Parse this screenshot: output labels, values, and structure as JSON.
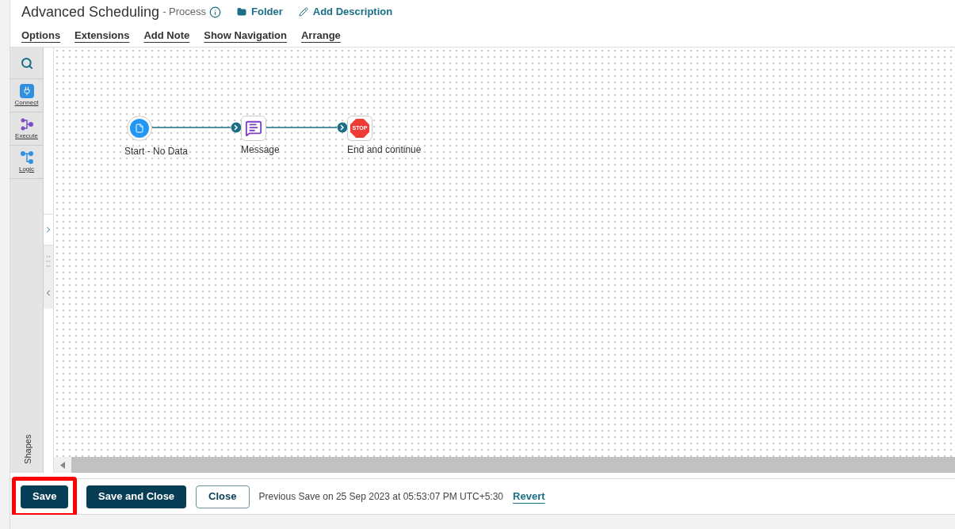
{
  "header": {
    "title": "Advanced Scheduling",
    "subtitle": "- Process",
    "links": [
      {
        "kind": "folder",
        "label": "Folder"
      },
      {
        "kind": "edit",
        "label": "Add Description"
      }
    ]
  },
  "menu": [
    "Options",
    "Extensions",
    "Add Note",
    "Show Navigation",
    "Arrange"
  ],
  "palette": [
    {
      "kind": "connect",
      "label": "Connect"
    },
    {
      "kind": "execute",
      "label": "Execute"
    },
    {
      "kind": "logic",
      "label": "Logic"
    }
  ],
  "shapes_label": "Shapes",
  "nodes": [
    {
      "kind": "start",
      "label": "Start - No Data"
    },
    {
      "kind": "message",
      "label": "Message"
    },
    {
      "kind": "stop",
      "label": "End and continue",
      "icon_text": "STOP"
    }
  ],
  "footer": {
    "buttons": [
      {
        "label": "Save",
        "kind": "primary",
        "highlighted": true
      },
      {
        "label": "Save and Close",
        "kind": "primary",
        "highlighted": false
      },
      {
        "label": "Close",
        "kind": "outline",
        "highlighted": false
      }
    ],
    "status": "Previous Save on 25 Sep 2023 at 05:53:07 PM UTC+5:30",
    "revert": "Revert"
  }
}
